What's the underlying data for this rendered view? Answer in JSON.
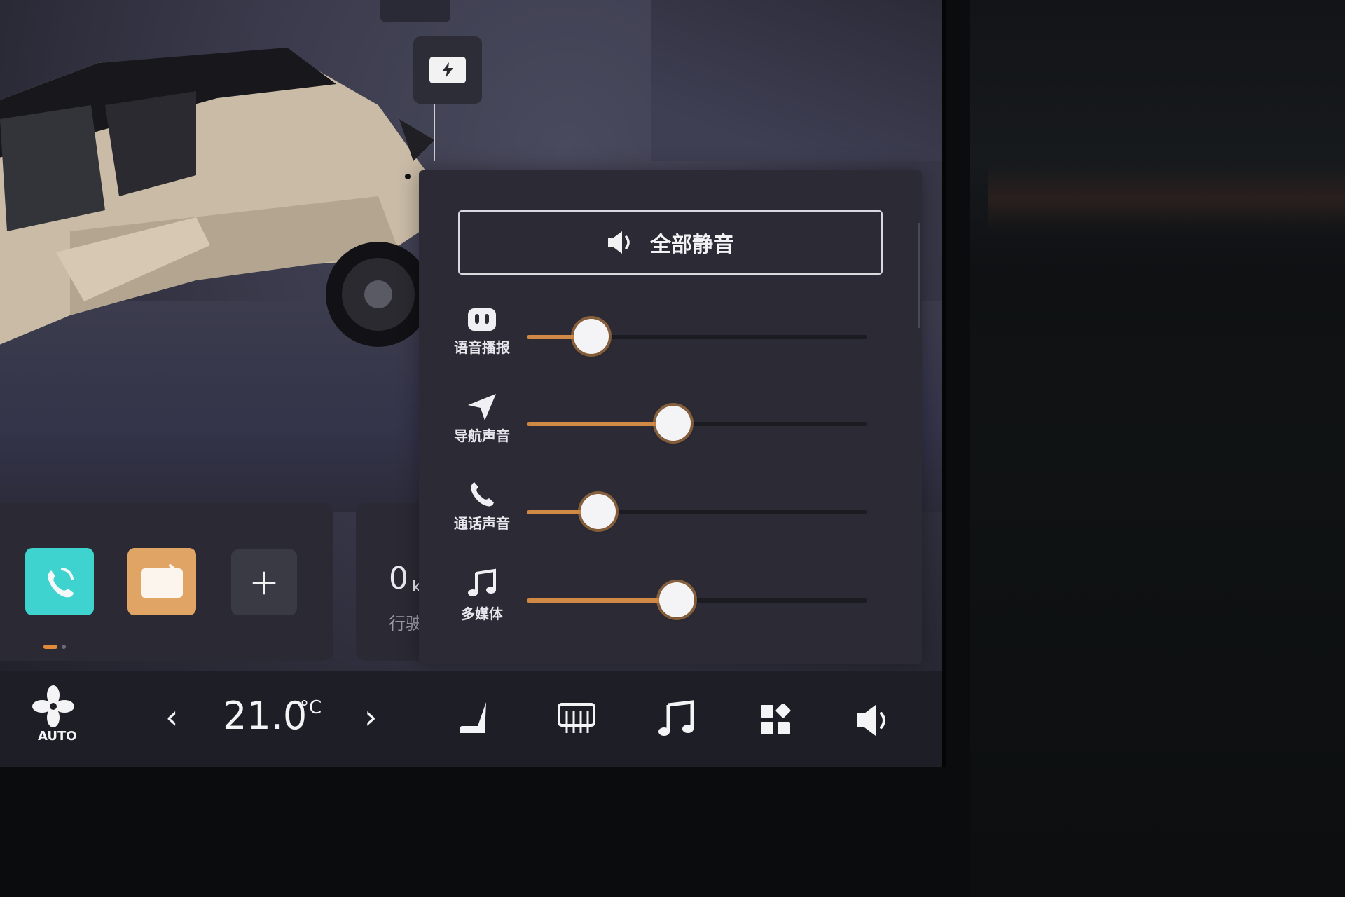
{
  "panel": {
    "mute_all_label": "全部静音",
    "sliders": [
      {
        "icon": "voice-broadcast-icon",
        "label": "语音播报",
        "level": 0.19
      },
      {
        "icon": "navigation-icon",
        "label": "导航声音",
        "level": 0.43
      },
      {
        "icon": "phone-call-icon",
        "label": "通话声音",
        "level": 0.21
      },
      {
        "icon": "music-note-icon",
        "label": "多媒体",
        "level": 0.44
      }
    ]
  },
  "dock": {
    "apps": [
      {
        "icon": "phone-app-icon",
        "color": "#3fd3d0"
      },
      {
        "icon": "notes-app-icon",
        "color": "#e0a565"
      },
      {
        "icon": "add-icon",
        "label": "+"
      }
    ]
  },
  "trip": {
    "value": "0",
    "unit": "k",
    "label": "行驶"
  },
  "climate": {
    "fan_mode": "AUTO",
    "temperature": "21.0",
    "unit": "°C"
  },
  "bottombar_icons": [
    "fan-auto-icon",
    "seat-heat-icon",
    "rear-defrost-icon",
    "music-icon",
    "apps-grid-icon",
    "volume-icon"
  ],
  "accent_color": "#d08a45"
}
